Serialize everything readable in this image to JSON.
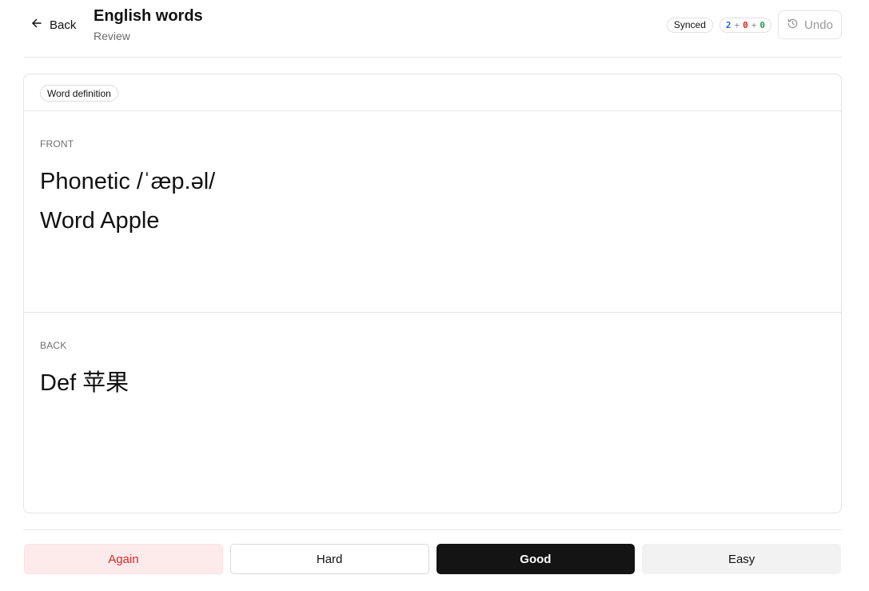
{
  "header": {
    "back_label": "Back",
    "title": "English words",
    "subtitle": "Review",
    "sync_status": "Synced",
    "counts": {
      "new": "2",
      "learning": "0",
      "review": "0",
      "plus": "+"
    },
    "undo_label": "Undo"
  },
  "card": {
    "note_type": "Word definition",
    "front": {
      "label": "FRONT",
      "lines": [
        "Phonetic /ˈæp.əl/",
        "Word Apple"
      ]
    },
    "back": {
      "label": "BACK",
      "lines": [
        "Def 苹果"
      ]
    }
  },
  "actions": {
    "again": "Again",
    "hard": "Hard",
    "good": "Good",
    "easy": "Easy"
  },
  "colors": {
    "new_count": "#2563eb",
    "learning_count": "#dc2626",
    "review_count": "#16a34a",
    "again_text": "#dc2626",
    "again_bg": "#fdeaea",
    "good_bg": "#141414"
  },
  "icons": {
    "back": "arrow-left-icon",
    "undo": "history-icon"
  }
}
